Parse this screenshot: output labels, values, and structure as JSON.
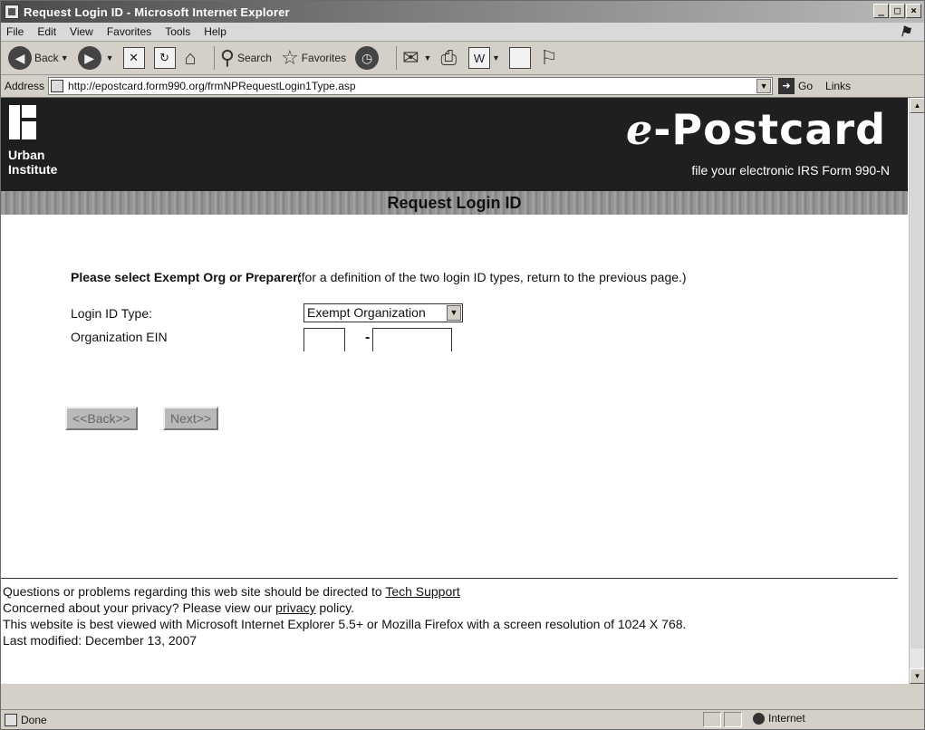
{
  "window": {
    "title": "Request Login ID - Microsoft Internet Explorer",
    "controls": [
      "_",
      "□",
      "×"
    ]
  },
  "menubar": {
    "items": [
      "File",
      "Edit",
      "View",
      "Favorites",
      "Tools",
      "Help"
    ]
  },
  "toolbar": {
    "back_label": "Back",
    "search_label": "Search",
    "favorites_label": "Favorites"
  },
  "addressbar": {
    "label": "Address",
    "url": "http://epostcard.form990.org/frmNPRequestLogin1Type.asp",
    "go_label": "Go",
    "links_label": "Links"
  },
  "banner": {
    "logo_line1": "Urban",
    "logo_line2": "Institute",
    "title_e": "e",
    "title_rest": "-Postcard",
    "subtitle": "file your electronic IRS Form 990-N"
  },
  "page_title": "Request Login ID",
  "form": {
    "prompt": "Please select Exempt Org or Preparer:",
    "note": "(for a definition of the two login ID types, return to the previous page.)",
    "login_type_label": "Login ID Type:",
    "login_type_value": "Exempt Organization",
    "ein_label": "Organization EIN",
    "ein_separator": "-",
    "ein_part1": "",
    "ein_part2": "",
    "back_button": "<<Back>>",
    "next_button": "Next>>"
  },
  "footer": {
    "line1_text": "Questions or problems regarding this web site should be directed to ",
    "line1_link": "Tech Support",
    "line2_text": "Concerned about your privacy? Please view our ",
    "line2_link": "privacy",
    "line2_end": " policy.",
    "line3": "This website is best viewed with Microsoft Internet Explorer 5.5+ or Mozilla Firefox with a screen resolution of 1024 X 768.",
    "line4": "Last modified: December 13, 2007"
  },
  "statusbar": {
    "status": "Done",
    "zone": "Internet"
  }
}
